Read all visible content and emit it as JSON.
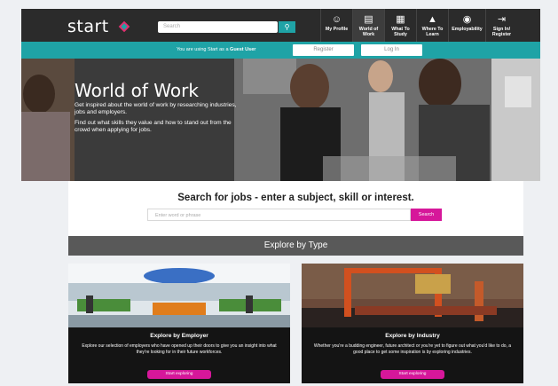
{
  "header": {
    "logo_text": "start",
    "search_placeholder": "Search",
    "nav": [
      {
        "label": "My Profile",
        "icon": "user-icon"
      },
      {
        "label": "World of Work",
        "icon": "briefcase-icon"
      },
      {
        "label": "What To Study",
        "icon": "book-icon"
      },
      {
        "label": "Where To Learn",
        "icon": "graduation-cap-icon"
      },
      {
        "label": "Employability",
        "icon": "badge-icon"
      },
      {
        "label": "Sign In/ Register",
        "icon": "sign-in-icon"
      }
    ]
  },
  "guest_bar": {
    "text_prefix": "You are using Start as a",
    "text_bold": "Guest User",
    "register_label": "Register",
    "login_label": "Log In"
  },
  "hero": {
    "title": "World of Work",
    "para1": "Get inspired about the world of work by researching industries, jobs and employers.",
    "para2": "Find out what skills they value and how to stand out from the crowd when applying for jobs."
  },
  "job_search": {
    "title": "Search for jobs - enter a subject, skill or interest.",
    "placeholder": "Enter word or phrase",
    "button_label": "Search"
  },
  "explore": {
    "title": "Explore by Type",
    "cards": [
      {
        "title": "Explore by Employer",
        "text": "Explore our selection of employers who have opened up their doors to give you an insight into what they're looking for in their future workforces.",
        "button_label": "Start exploring"
      },
      {
        "title": "Explore by Industry",
        "text": "Whether you're a budding engineer, future architect or you're yet to figure out what you'd like to do, a good place to get some inspiration is by exploring industries.",
        "button_label": "Start exploring"
      }
    ]
  },
  "colors": {
    "teal": "#1fa3a6",
    "magenta": "#d6179a",
    "dark": "#2b2b2b"
  }
}
